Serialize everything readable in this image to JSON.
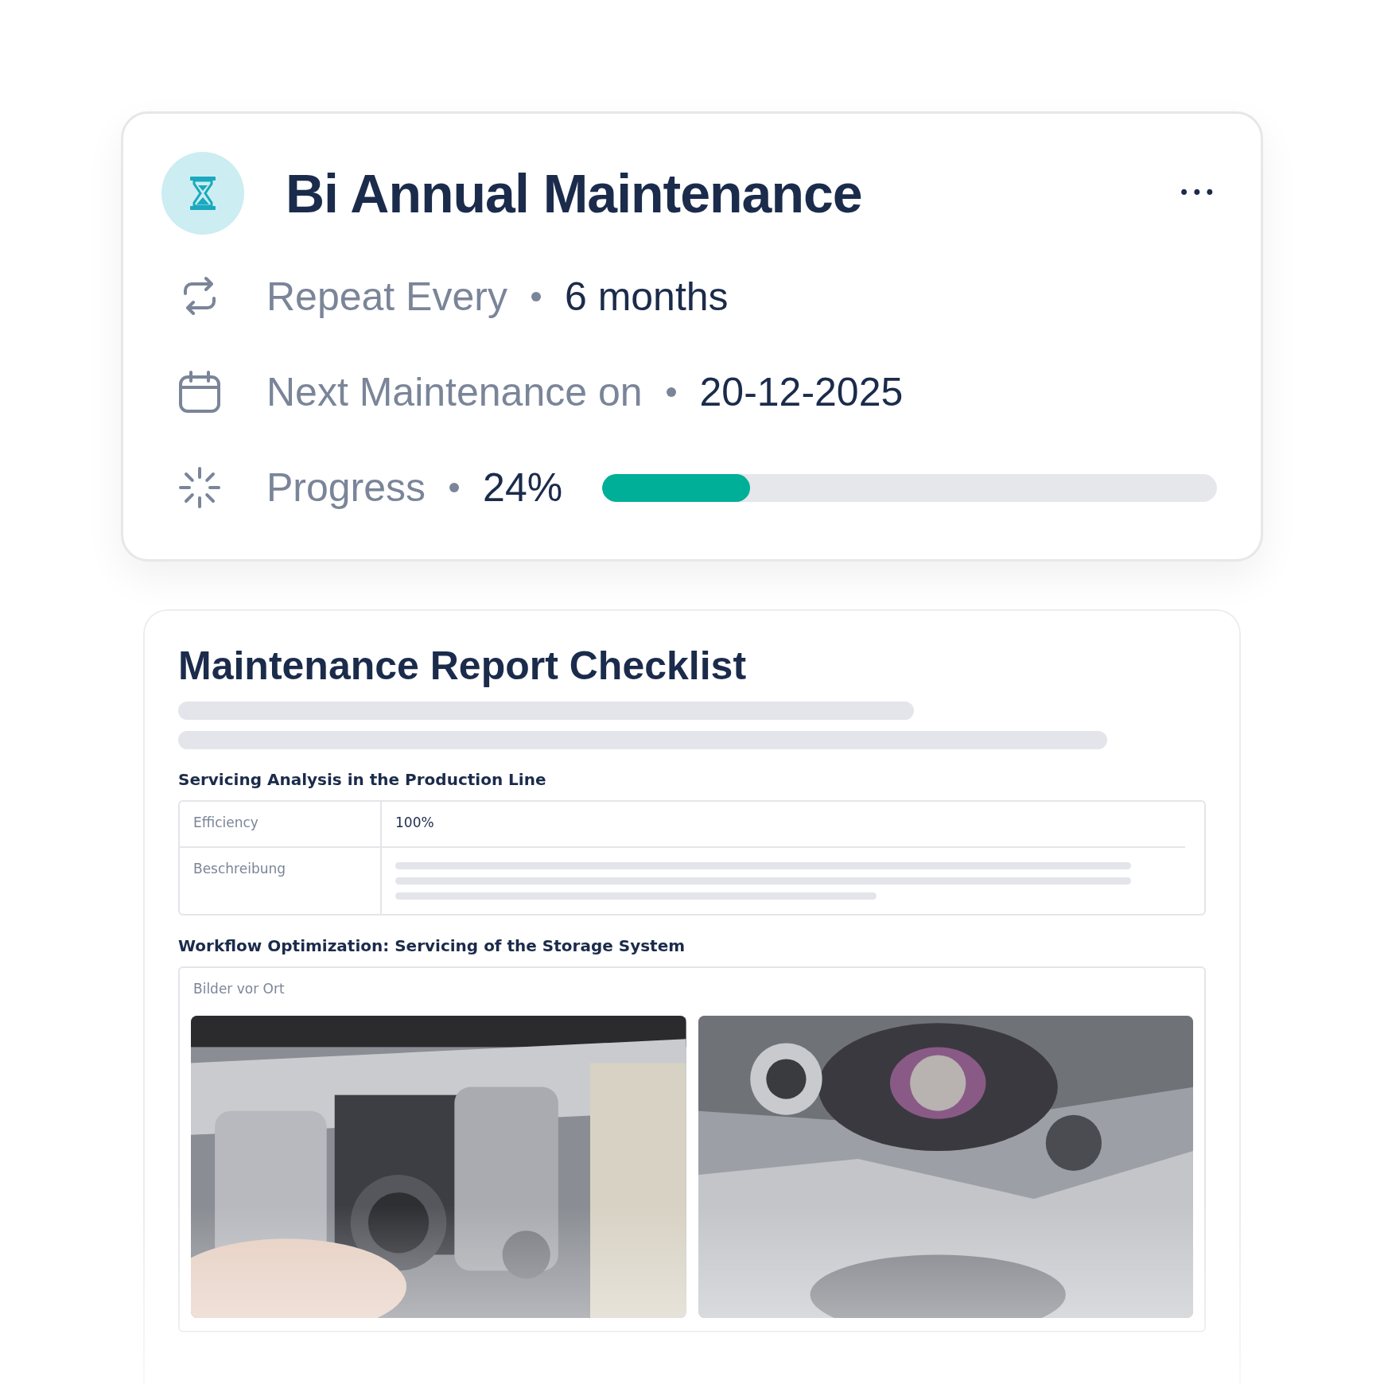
{
  "task_card": {
    "title": "Bi Annual Maintenance",
    "menu_icon": "•••",
    "details": [
      {
        "kind": "repeat",
        "label": "Repeat Every",
        "value": "6 months"
      },
      {
        "kind": "date",
        "label": "Next Maintenance on",
        "value": "20-12-2025"
      },
      {
        "kind": "progress",
        "label": "Progress",
        "value": "24%",
        "level": 0.24
      }
    ]
  },
  "report": {
    "title": "Maintenance Report Checklist",
    "sections": [
      {
        "kind": "table",
        "heading": "Servicing Analysis in the Production Line",
        "rows": [
          {
            "label": "Efficiency",
            "value": "100%"
          },
          {
            "label": "Beschreibung",
            "kind": "skeleton"
          }
        ]
      },
      {
        "kind": "photos",
        "heading": "Workflow Optimization: Servicing of the Storage System",
        "label": "Bilder vor Ort"
      }
    ]
  }
}
